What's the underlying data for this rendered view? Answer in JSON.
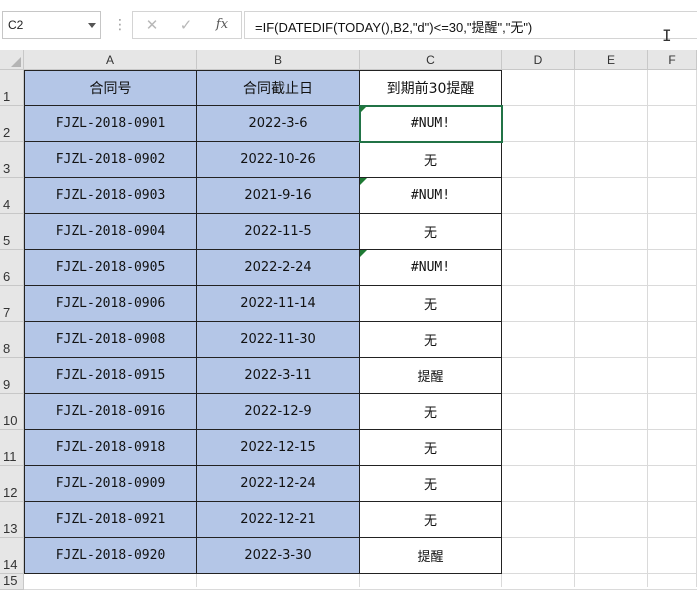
{
  "formula_bar": {
    "name_box": "C2",
    "separator": "⋮",
    "cancel_glyph": "✕",
    "enter_glyph": "✓",
    "fx_label": "fx",
    "formula": "=IF(DATEDIF(TODAY(),B2,\"d\")<=30,\"提醒\",\"无\")",
    "cursor_glyph": "I"
  },
  "columns": [
    "A",
    "B",
    "C",
    "D",
    "E",
    "F"
  ],
  "rows": [
    "1",
    "2",
    "3",
    "4",
    "5",
    "6",
    "7",
    "8",
    "9",
    "10",
    "11",
    "12",
    "13",
    "14",
    "15"
  ],
  "table": {
    "headers": [
      "合同号",
      "合同截止日",
      "到期前30提醒"
    ],
    "rows": [
      {
        "contract": "FJZL-2018-0901",
        "deadline": "2022-3-6",
        "reminder": "#NUM!",
        "error": true
      },
      {
        "contract": "FJZL-2018-0902",
        "deadline": "2022-10-26",
        "reminder": "无",
        "error": false
      },
      {
        "contract": "FJZL-2018-0903",
        "deadline": "2021-9-16",
        "reminder": "#NUM!",
        "error": true
      },
      {
        "contract": "FJZL-2018-0904",
        "deadline": "2022-11-5",
        "reminder": "无",
        "error": false
      },
      {
        "contract": "FJZL-2018-0905",
        "deadline": "2022-2-24",
        "reminder": "#NUM!",
        "error": true
      },
      {
        "contract": "FJZL-2018-0906",
        "deadline": "2022-11-14",
        "reminder": "无",
        "error": false
      },
      {
        "contract": "FJZL-2018-0908",
        "deadline": "2022-11-30",
        "reminder": "无",
        "error": false
      },
      {
        "contract": "FJZL-2018-0915",
        "deadline": "2022-3-11",
        "reminder": "提醒",
        "error": false
      },
      {
        "contract": "FJZL-2018-0916",
        "deadline": "2022-12-9",
        "reminder": "无",
        "error": false
      },
      {
        "contract": "FJZL-2018-0918",
        "deadline": "2022-12-15",
        "reminder": "无",
        "error": false
      },
      {
        "contract": "FJZL-2018-0909",
        "deadline": "2022-12-24",
        "reminder": "无",
        "error": false
      },
      {
        "contract": "FJZL-2018-0921",
        "deadline": "2022-12-21",
        "reminder": "无",
        "error": false
      },
      {
        "contract": "FJZL-2018-0920",
        "deadline": "2022-3-30",
        "reminder": "提醒",
        "error": false
      }
    ]
  },
  "selected_cell": "C2",
  "colors": {
    "highlight_fill": "#b4c6e7",
    "selection": "#217346",
    "error_indicator": "#1e7a34"
  }
}
